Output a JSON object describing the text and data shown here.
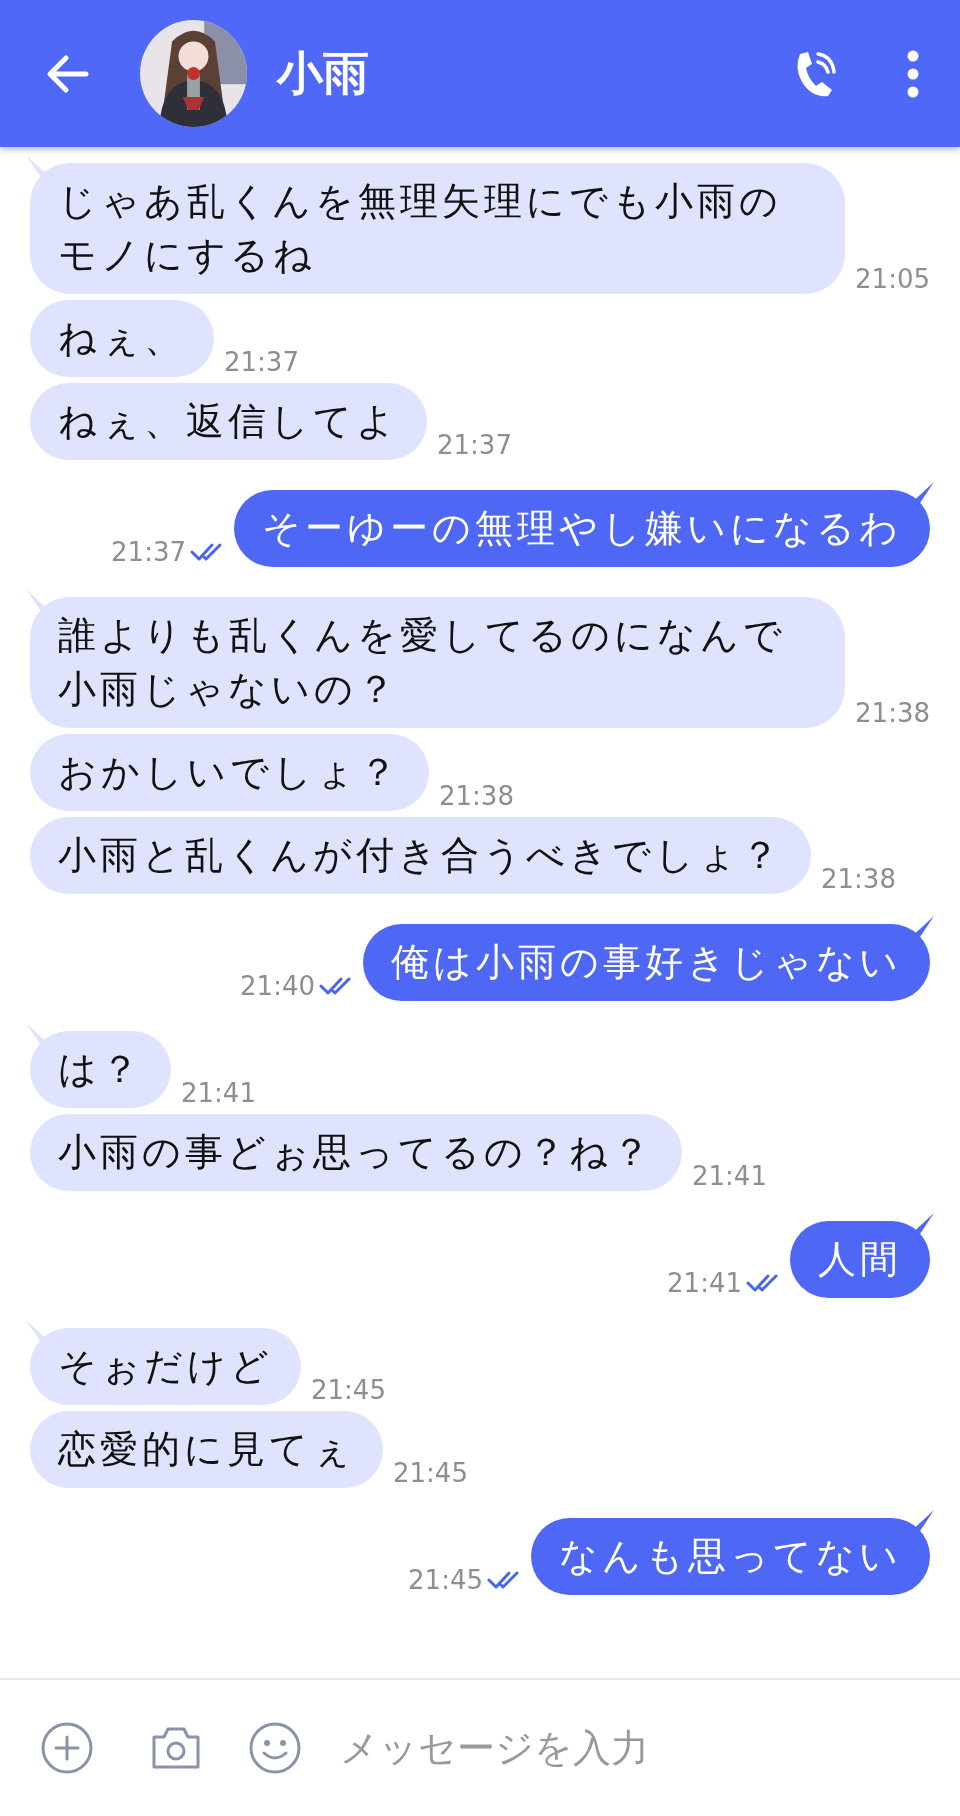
{
  "header": {
    "title": "小雨"
  },
  "messages": [
    {
      "kind": "incoming",
      "tail": true,
      "text": "じゃあ乱くんを無理矢理にでも小雨のモノにするね",
      "time": "21:05"
    },
    {
      "kind": "incoming",
      "tail": false,
      "text": "ねぇ、",
      "time": "21:37"
    },
    {
      "kind": "incoming",
      "tail": false,
      "text": "ねぇ、返信してよ",
      "time": "21:37"
    },
    {
      "kind": "outgoing",
      "tail": true,
      "text": "そーゆーの無理やし嫌いになるわ",
      "time": "21:37",
      "read": true
    },
    {
      "kind": "incoming",
      "tail": true,
      "text": "誰よりも乱くんを愛してるのになんで小雨じゃないの？",
      "time": "21:38"
    },
    {
      "kind": "incoming",
      "tail": false,
      "text": "おかしいでしょ？",
      "time": "21:38"
    },
    {
      "kind": "incoming",
      "tail": false,
      "text": "小雨と乱くんが付き合うべきでしょ？",
      "time": "21:38"
    },
    {
      "kind": "outgoing",
      "tail": true,
      "text": "俺は小雨の事好きじゃない",
      "time": "21:40",
      "read": true
    },
    {
      "kind": "incoming",
      "tail": true,
      "text": "は？",
      "time": "21:41"
    },
    {
      "kind": "incoming",
      "tail": false,
      "text": "小雨の事どぉ思ってるの？ね？",
      "time": "21:41"
    },
    {
      "kind": "outgoing",
      "tail": true,
      "text": "人間",
      "time": "21:41",
      "read": true
    },
    {
      "kind": "incoming",
      "tail": true,
      "text": "そぉだけど",
      "time": "21:45"
    },
    {
      "kind": "incoming",
      "tail": false,
      "text": "恋愛的に見てぇ",
      "time": "21:45"
    },
    {
      "kind": "outgoing",
      "tail": true,
      "text": "なんも思ってない",
      "time": "21:45",
      "read": true
    }
  ],
  "composer": {
    "placeholder": "メッセージを入力"
  }
}
